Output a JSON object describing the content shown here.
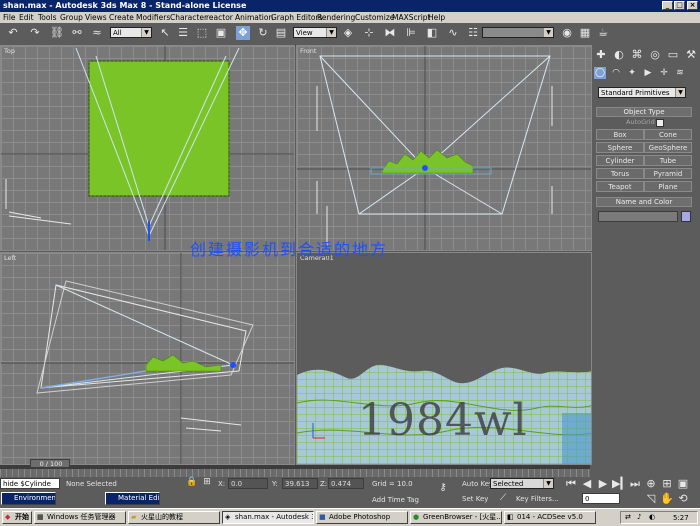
{
  "window": {
    "title": "shan.max - Autodesk 3ds Max 8  - Stand-alone License"
  },
  "menu": [
    "File",
    "Edit",
    "Tools",
    "Group",
    "Views",
    "Create",
    "Modifiers",
    "Character",
    "reactor",
    "Animation",
    "Graph Editors",
    "Rendering",
    "Customize",
    "MAXScript",
    "Help"
  ],
  "toolbar": {
    "selection_filter": "All",
    "ref_coord": "View",
    "named_selection": ""
  },
  "viewports": {
    "top": "Top",
    "front": "Front",
    "left": "Left",
    "camera": "Camera01"
  },
  "overlay_text": "创建摄影机到合适的地方",
  "watermark_text": "1984wl",
  "command_panel": {
    "category": "Standard Primitives",
    "object_type_title": "Object Type",
    "autogrid_label": "AutoGrid",
    "buttons": [
      "Box",
      "Cone",
      "Sphere",
      "GeoSphere",
      "Cylinder",
      "Tube",
      "Torus",
      "Pyramid",
      "Teapot",
      "Plane"
    ],
    "name_color_title": "Name and Color",
    "name_value": "",
    "swatch_color": "#a8a8e8"
  },
  "trackbar": {
    "frame": "0 / 100"
  },
  "status": {
    "maxscript_listener": "hide $Cylinde",
    "selection": "None Selected",
    "x_label": "X:",
    "x_value": "0.0",
    "y_label": "Y:",
    "y_value": "39.613",
    "z_label": "Z:",
    "z_value": "0.474",
    "grid": "Grid = 10.0",
    "add_time_tag": "Add Time Tag",
    "auto_key": "Auto Key",
    "set_key": "Set Key",
    "key_mode": "Selected",
    "key_filters": "Key Filters...",
    "current_frame": "0"
  },
  "floating_windows": [
    "Environment...",
    "Material Edit..."
  ],
  "taskbar": {
    "start": "开始",
    "tasks": [
      "Windows 任务管理器",
      "火星山的教程",
      "shan.max - Autodesk 3...",
      "Adobe Photoshop",
      "GreenBrowser - [火星...",
      "014 - ACDSee v5.0"
    ],
    "clock": "5:27"
  },
  "colors": {
    "title_bar": "#0a246a",
    "viewport_bg": "#787878",
    "terrain_green": "#7ac428",
    "highlight_blue": "#1e50ff"
  }
}
